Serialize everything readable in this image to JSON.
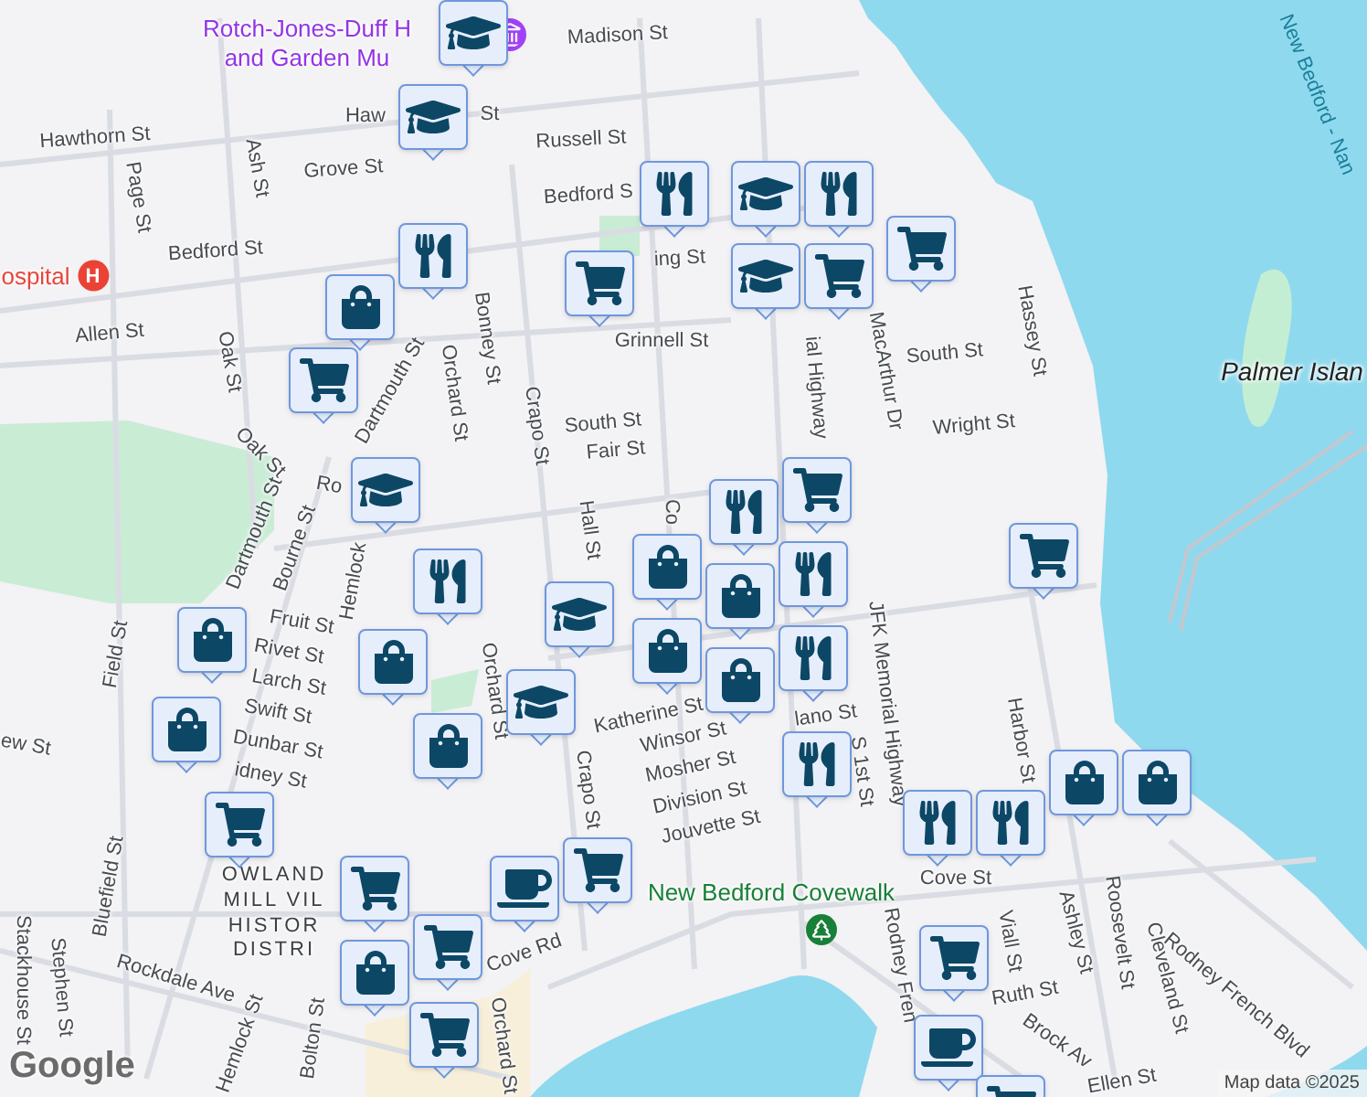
{
  "map": {
    "labels": [
      {
        "kind": "poi",
        "lines": [
          "Rotch-Jones-Duff H",
          "and Garden Mu"
        ]
      },
      {
        "kind": "street",
        "text": "Madison St"
      },
      {
        "kind": "street",
        "text": "Hawthorn St"
      },
      {
        "kind": "street",
        "text": "Haw"
      },
      {
        "kind": "street",
        "text": "St"
      },
      {
        "kind": "street",
        "text": "Russell St"
      },
      {
        "kind": "street",
        "text": "Page St"
      },
      {
        "kind": "street",
        "text": "Ash St"
      },
      {
        "kind": "street",
        "text": "Grove St"
      },
      {
        "kind": "street",
        "text": "Bedford S"
      },
      {
        "kind": "street",
        "text": "Bedford St"
      },
      {
        "kind": "hospital",
        "text": "ospital",
        "badge": "H"
      },
      {
        "kind": "street",
        "text": "ing St"
      },
      {
        "kind": "street",
        "text": "Allen St"
      },
      {
        "kind": "street",
        "text": "Oak St"
      },
      {
        "kind": "street",
        "text": "Oak St"
      },
      {
        "kind": "street",
        "text": "Dartmouth St"
      },
      {
        "kind": "street",
        "text": "Orchard St"
      },
      {
        "kind": "street",
        "text": "Bonney St"
      },
      {
        "kind": "street",
        "text": "Grinnell St"
      },
      {
        "kind": "street",
        "text": "South St"
      },
      {
        "kind": "street",
        "text": "Crapo St"
      },
      {
        "kind": "street",
        "text": "Fair St"
      },
      {
        "kind": "street",
        "text": "Hall St"
      },
      {
        "kind": "street",
        "text": "Co"
      },
      {
        "kind": "street",
        "text": "Ro"
      },
      {
        "kind": "street",
        "text": "ial Highway"
      },
      {
        "kind": "street",
        "text": "MacArthur Dr"
      },
      {
        "kind": "street",
        "text": "South St"
      },
      {
        "kind": "street",
        "text": "Hassey St"
      },
      {
        "kind": "street",
        "text": "Wright St"
      },
      {
        "kind": "island",
        "text": "Palmer Islan"
      },
      {
        "kind": "ferry",
        "text": "New Bedford - Nan"
      },
      {
        "kind": "street",
        "text": "Dartmouth St"
      },
      {
        "kind": "street",
        "text": "Bourne St"
      },
      {
        "kind": "street",
        "text": "Hemlock"
      },
      {
        "kind": "street",
        "text": "Fruit St"
      },
      {
        "kind": "street",
        "text": "Rivet St"
      },
      {
        "kind": "street",
        "text": "Larch St"
      },
      {
        "kind": "street",
        "text": "Swift St"
      },
      {
        "kind": "street",
        "text": "Dunbar St"
      },
      {
        "kind": "street",
        "text": "idney St"
      },
      {
        "kind": "street",
        "text": "Field St"
      },
      {
        "kind": "street",
        "text": "ew St"
      },
      {
        "kind": "street",
        "text": "Bluefield St"
      },
      {
        "kind": "street",
        "text": "Stackhouse St"
      },
      {
        "kind": "street",
        "text": "Stephen St"
      },
      {
        "kind": "street",
        "text": "Rockdale Ave"
      },
      {
        "kind": "street",
        "text": "Hemlock St"
      },
      {
        "kind": "street",
        "text": "Bolton St"
      },
      {
        "kind": "street",
        "text": "Cove Rd"
      },
      {
        "kind": "street",
        "text": "Orchard St"
      },
      {
        "kind": "street",
        "text": "Orchard St"
      },
      {
        "kind": "district",
        "lines": [
          "OWLAND",
          "MILL VIL",
          "HISTOR",
          "DISTRI"
        ]
      },
      {
        "kind": "street",
        "text": "Katherine St"
      },
      {
        "kind": "street",
        "text": "Winsor St"
      },
      {
        "kind": "street",
        "text": "Mosher St"
      },
      {
        "kind": "street",
        "text": "Division St"
      },
      {
        "kind": "street",
        "text": "Jouvette St"
      },
      {
        "kind": "street",
        "text": "Crapo St"
      },
      {
        "kind": "street",
        "text": "lano St"
      },
      {
        "kind": "street",
        "text": "S 1st St"
      },
      {
        "kind": "street",
        "text": "JFK Memorial Highway"
      },
      {
        "kind": "street",
        "text": "Cove St"
      },
      {
        "kind": "street",
        "text": "Rodney Fren"
      },
      {
        "kind": "street",
        "text": "Harbor St"
      },
      {
        "kind": "street",
        "text": "Viall St"
      },
      {
        "kind": "street",
        "text": "Ashley St"
      },
      {
        "kind": "street",
        "text": "Roosevelt St"
      },
      {
        "kind": "street",
        "text": "Cleveland St"
      },
      {
        "kind": "street",
        "text": "Ruth St"
      },
      {
        "kind": "street",
        "text": "Rodney French Blvd"
      },
      {
        "kind": "street",
        "text": "Brock Av"
      },
      {
        "kind": "street",
        "text": "Ellen St"
      },
      {
        "kind": "park",
        "text": "New Bedford Covewalk"
      }
    ],
    "pins": [
      {
        "kind": "cap"
      },
      {
        "kind": "cap"
      },
      {
        "kind": "fork"
      },
      {
        "kind": "fork"
      },
      {
        "kind": "cart"
      },
      {
        "kind": "bag"
      },
      {
        "kind": "cart"
      },
      {
        "kind": "cap"
      },
      {
        "kind": "fork"
      },
      {
        "kind": "cap"
      },
      {
        "kind": "cart"
      },
      {
        "kind": "cart"
      },
      {
        "kind": "cap"
      },
      {
        "kind": "cart"
      },
      {
        "kind": "fork"
      },
      {
        "kind": "bag"
      },
      {
        "kind": "bag"
      },
      {
        "kind": "bag"
      },
      {
        "kind": "cap"
      },
      {
        "kind": "fork"
      },
      {
        "kind": "bag"
      },
      {
        "kind": "bag"
      },
      {
        "kind": "fork"
      },
      {
        "kind": "fork"
      },
      {
        "kind": "cap"
      },
      {
        "kind": "bag"
      },
      {
        "kind": "bag"
      },
      {
        "kind": "bag"
      },
      {
        "kind": "fork"
      },
      {
        "kind": "cart"
      },
      {
        "kind": "cart"
      },
      {
        "kind": "bag"
      },
      {
        "kind": "bag"
      },
      {
        "kind": "fork"
      },
      {
        "kind": "fork"
      },
      {
        "kind": "cart"
      },
      {
        "kind": "cup"
      },
      {
        "kind": "cart"
      },
      {
        "kind": "cart"
      },
      {
        "kind": "bag"
      },
      {
        "kind": "cart"
      },
      {
        "kind": "cart"
      },
      {
        "kind": "cup"
      },
      {
        "kind": "cart"
      }
    ]
  },
  "attribution": {
    "logo": "Google",
    "text": "Map data ©2025"
  }
}
